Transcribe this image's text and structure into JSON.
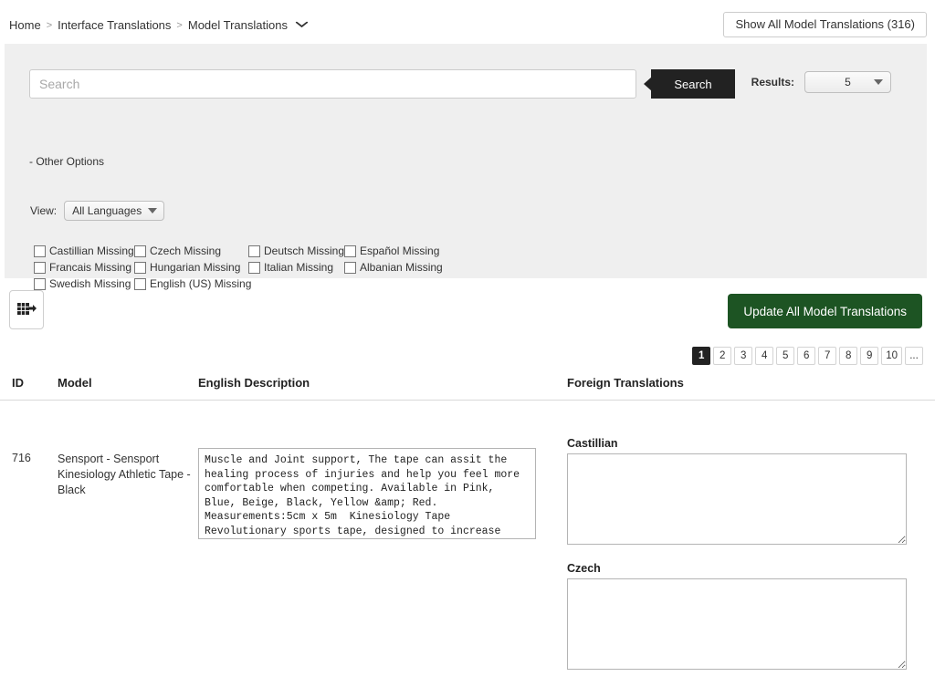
{
  "breadcrumb": {
    "items": [
      "Home",
      "Interface Translations",
      "Model Translations"
    ],
    "separator": ">",
    "caret": "⌄"
  },
  "header": {
    "show_all_button": "Show All Model Translations (316)"
  },
  "search_panel": {
    "search_placeholder": "Search",
    "search_value": "",
    "search_button": "Search",
    "results_label": "Results:",
    "results_value": "5",
    "other_options": "- Other Options",
    "view_label": "View:",
    "view_value": "All Languages",
    "checkbox_rows": [
      [
        "Castillian Missing",
        "Czech Missing",
        "Deutsch Missing",
        "Español Missing"
      ],
      [
        "Francais Missing",
        "Hungarian Missing",
        "Italian Missing",
        "Albanian Missing"
      ],
      [
        "Swedish Missing",
        "English (US) Missing"
      ]
    ]
  },
  "toolbar": {
    "export_icon": "export-grid-arrow-icon",
    "update_button": "Update All Model Translations"
  },
  "pagination": {
    "pages": [
      "1",
      "2",
      "3",
      "4",
      "5",
      "6",
      "7",
      "8",
      "9",
      "10",
      "..."
    ],
    "active_index": 0
  },
  "table": {
    "headers": {
      "id": "ID",
      "model": "Model",
      "english_description": "English Description",
      "foreign_translations": "Foreign Translations"
    },
    "rows": [
      {
        "id": "716",
        "model": "Sensport - Sensport Kinesiology Athletic Tape - Black",
        "english_description": "Muscle and Joint support, The tape can assit the healing process of injuries and help you feel more comfortable when competing. Available in Pink, Blue, Beige, Black, Yellow &amp; Red. Measurements:5cm x 5m  Kinesiology Tape Revolutionary sports tape, designed to increase",
        "translations": [
          {
            "language": "Castillian",
            "value": ""
          },
          {
            "language": "Czech",
            "value": ""
          }
        ]
      }
    ]
  },
  "colors": {
    "panel_bg": "#efefef",
    "search_button_bg": "#222222",
    "update_button_bg": "#1d5423",
    "active_page_bg": "#222222"
  }
}
